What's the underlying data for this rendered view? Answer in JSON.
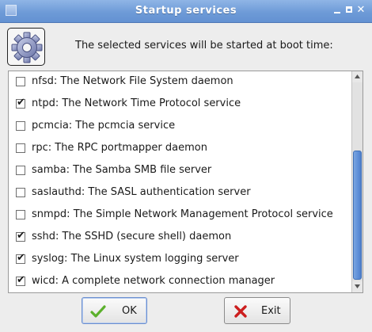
{
  "window": {
    "title": "Startup services",
    "controls": {
      "minimize": "minimize-icon",
      "maximize": "maximize-icon",
      "close": "close-icon"
    }
  },
  "header": {
    "icon": "gear-icon",
    "text": "The selected services will be started at boot time:"
  },
  "services": [
    {
      "label": "nfsd: The Network File System daemon",
      "checked": false
    },
    {
      "label": "ntpd: The Network Time Protocol service",
      "checked": true
    },
    {
      "label": "pcmcia: The pcmcia service",
      "checked": false
    },
    {
      "label": "rpc: The RPC portmapper daemon",
      "checked": false
    },
    {
      "label": "samba: The Samba SMB file server",
      "checked": false
    },
    {
      "label": "saslauthd: The SASL authentication server",
      "checked": false
    },
    {
      "label": "snmpd: The Simple Network Management Protocol service",
      "checked": false
    },
    {
      "label": "sshd: The SSHD (secure shell) daemon",
      "checked": true
    },
    {
      "label": "syslog: The Linux system logging server",
      "checked": true
    },
    {
      "label": "wicd: A complete network connection manager",
      "checked": true
    }
  ],
  "buttons": {
    "ok": {
      "label": "OK",
      "icon": "checkmark-icon"
    },
    "exit": {
      "label": "Exit",
      "icon": "cross-icon"
    }
  },
  "colors": {
    "titlebar": "#6e9bd7",
    "scroll_thumb": "#5e8fd8",
    "ok_check": "#5bb02c",
    "exit_cross": "#cc1e1e"
  }
}
